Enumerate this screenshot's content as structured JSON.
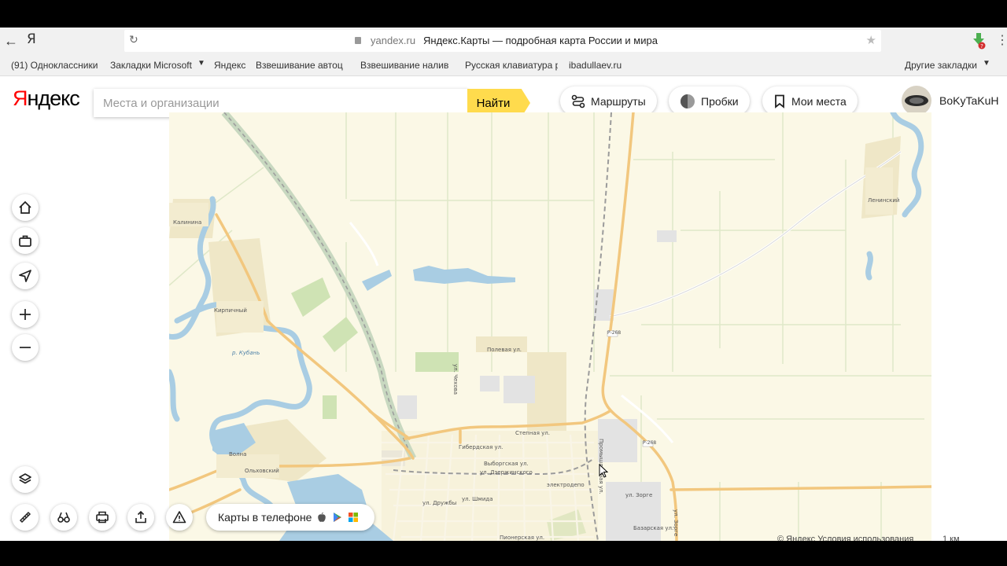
{
  "browser": {
    "ya_glyph": "Я",
    "domain": "yandex.ru",
    "page_title": "Яндекс.Карты — подробная карта России и мира",
    "bookmarks": [
      {
        "label": "(91) Одноклассники"
      },
      {
        "label": "Закладки Microsoft"
      },
      {
        "label": "Яндекс"
      },
      {
        "label": "Взвешивание автоц"
      },
      {
        "label": "Взвешивание налив"
      },
      {
        "label": "Русская клавиатура р"
      },
      {
        "label": "ibadullaev.ru"
      }
    ],
    "other_bookmarks": "Другие закладки"
  },
  "header": {
    "logo": "Яндекс",
    "search_placeholder": "Места и организации",
    "find_label": "Найти",
    "routes_label": "Маршруты",
    "traffic_label": "Пробки",
    "my_places_label": "Мои места",
    "username": "BoKyTaKuH"
  },
  "map": {
    "labels": {
      "kalinina": "Калинина",
      "kirpichny": "Кирпичный",
      "kuban": "р. Кубань",
      "volna": "Волна",
      "olkhovsky": "Ольховский",
      "leninsky": "Ленинский",
      "polevaya": "Полевая ул.",
      "stepnaya": "Степная ул.",
      "vyborgskaya": "Выборгская ул.",
      "gribnaya": "Гибердская ул.",
      "sadovaya": "ул. Дзержинского",
      "r268a": "Р-268",
      "r268b": "Р-268",
      "zorge": "ул. Зорге",
      "zorge2": "ул. Зорге",
      "bazarnaya": "Базарская ул.",
      "promyshl": "Промышленная ул.",
      "druzhby": "ул. Дружбы",
      "shmida": "ул. Шмида",
      "pionerskaya": "Пионерская ул.",
      "chekhova": "ул. Чехова",
      "elektrodep": "электродепо"
    },
    "copyright": "© Яндекс Условия использования",
    "scale": "1 км"
  },
  "footer": {
    "phone_label": "Карты в телефоне"
  },
  "colors": {
    "map_bg": "#fbf8e6",
    "water": "#a9cde3",
    "road_major": "#f2c77e",
    "green": "#cfe3b4",
    "accent_yellow": "#ffdb4d"
  }
}
